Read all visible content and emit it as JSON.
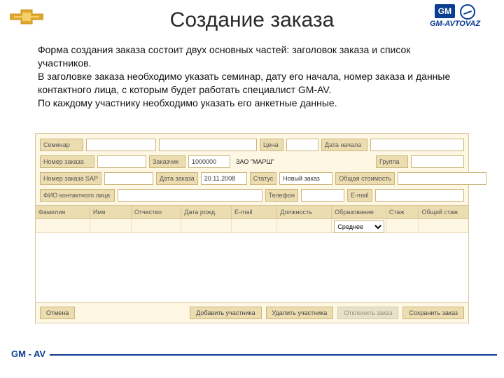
{
  "branding": {
    "gm_label": "GM",
    "gm_avtovaz": "GM-AVTOVAZ",
    "footer": "GM - AV"
  },
  "title": "Создание заказа",
  "intro": {
    "p1": "Форма создания заказа состоит двух основных частей: заголовок заказа и список участников.",
    "p2": "В заголовке заказа необходимо указать семинар, дату его начала, номер заказа и данные контактного лица, с которым будет работать специалист GM-AV.",
    "p3": "По каждому участнику необходимо указать его анкетные данные."
  },
  "header_fields": {
    "seminar_label": "Семинар",
    "price_label": "Цена",
    "start_date_label": "Дата начала",
    "order_no_label": "Номер заказа",
    "customer_label": "Заказчик",
    "customer_value": "1000000",
    "customer_name": "ЗАО \"МАРШ\"",
    "group_label": "Группа",
    "order_sap_label": "Номер заказа SAP",
    "order_date_label": "Дата заказа",
    "order_date_value": "20.11.2008",
    "status_label": "Статус",
    "status_value": "Новый заказ",
    "total_cost_label": "Общая стоимость",
    "contact_fio_label": "ФИО контактного лица",
    "phone_label": "Телефон",
    "email_label": "E-mail"
  },
  "table": {
    "columns": {
      "surname": "Фамилия",
      "name": "Имя",
      "patronymic": "Отчество",
      "birth": "Дата рожд.",
      "email": "E-mail",
      "position": "Должность",
      "education": "Образование",
      "experience": "Стаж",
      "total_experience": "Общий стаж"
    },
    "row": {
      "education_value": "Среднее"
    }
  },
  "buttons": {
    "cancel": "Отмена",
    "add_participant": "Добавить участника",
    "delete_participant": "Удалить участника",
    "decline_order": "Отклонить заказ",
    "save_order": "Сохранить заказ"
  }
}
